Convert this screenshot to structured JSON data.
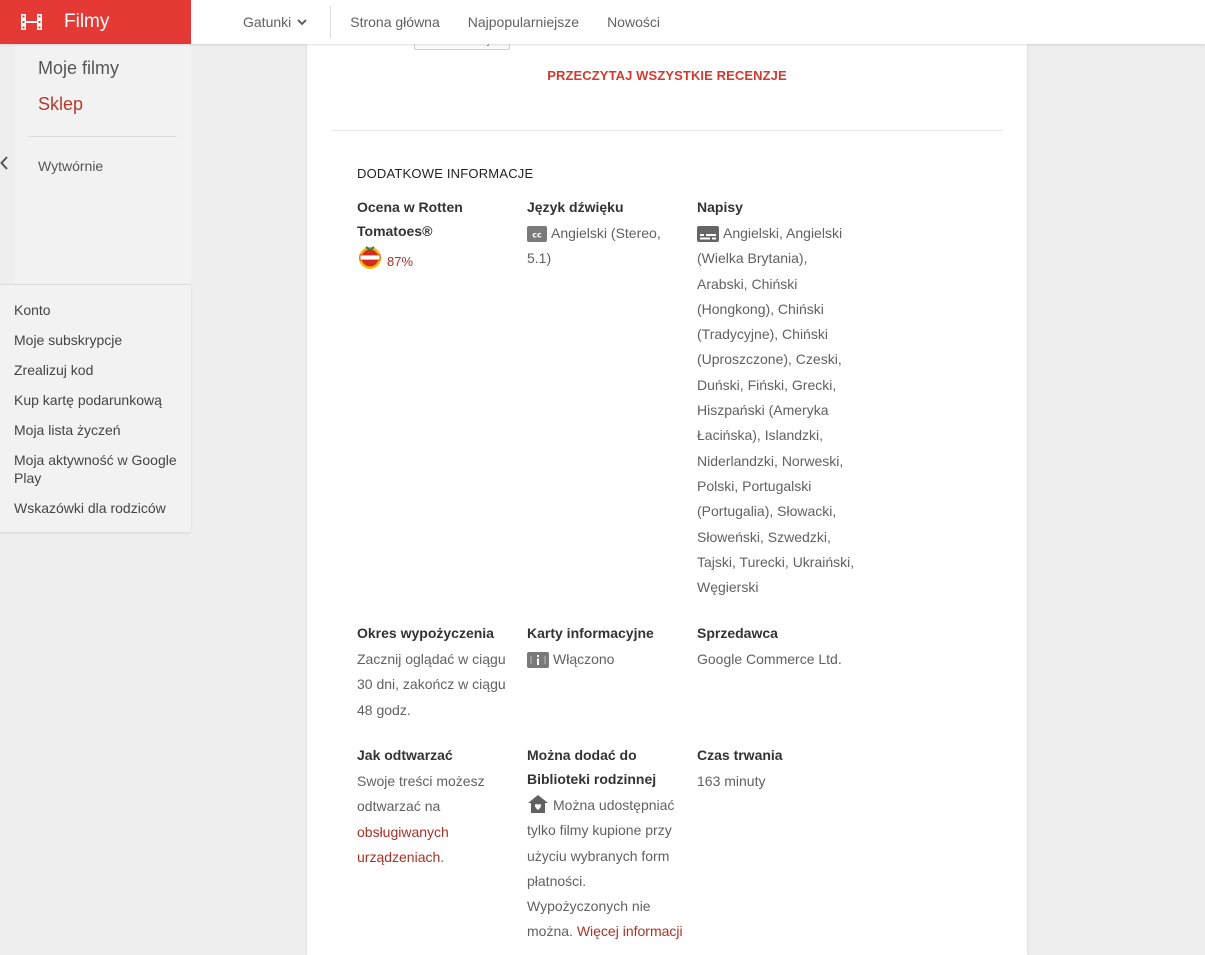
{
  "app": {
    "title": "Filmy"
  },
  "nav": {
    "genres": "Gatunki",
    "links": [
      "Strona główna",
      "Najpopularniejsze",
      "Nowości"
    ]
  },
  "sidebar": {
    "main": [
      "Moje filmy",
      "Sklep"
    ],
    "active": "Sklep",
    "studios": "Wytwórnie",
    "menu": [
      "Konto",
      "Moje subskrypcje",
      "Zrealizuj kod",
      "Kup kartę podarunkową",
      "Moja lista życzeń",
      "Moja aktywność w Google Play",
      "Wskazówki dla rodziców"
    ]
  },
  "reviews": {
    "full_review_button": "Pełna recenzja",
    "read_all": "PRZECZYTAJ WSZYSTKIE RECENZJE"
  },
  "additional_info": {
    "title": "DODATKOWE INFORMACJE",
    "rotten": {
      "label": "Ocena w Rotten Tomatoes®",
      "value": "87%"
    },
    "audio": {
      "label": "Język dźwięku",
      "value": "Angielski (Stereo, 5.1)"
    },
    "subtitles": {
      "label": "Napisy",
      "value": "Angielski, Angielski (Wielka Brytania), Arabski, Chiński (Hongkong), Chiński (Tradycyjne), Chiński (Uproszczone), Czeski, Duński, Fiński, Grecki, Hiszpański (Ameryka Łacińska), Islandzki, Niderlandzki, Norweski, Polski, Portugalski (Portugalia), Słowacki, Słoweński, Szwedzki, Tajski, Turecki, Ukraiński, Węgierski"
    },
    "rental": {
      "label": "Okres wypożyczenia",
      "value": "Zacznij oglądać w ciągu 30 dni, zakończ w ciągu 48 godz."
    },
    "info_cards": {
      "label": "Karty informacyjne",
      "value": "Włączono"
    },
    "seller": {
      "label": "Sprzedawca",
      "value": "Google Commerce Ltd."
    },
    "how_to_play": {
      "label": "Jak odtwarzać",
      "text": "Swoje treści możesz odtwarzać na ",
      "link": "obsługiwanych urządzeniach",
      "after": "."
    },
    "family": {
      "label": "Można dodać do Biblioteki rodzinnej",
      "text": "Można udostępniać tylko filmy kupione przy użyciu wybranych form płatności. Wypożyczonych nie można. ",
      "link": "Więcej informacji"
    },
    "duration": {
      "label": "Czas trwania",
      "value": "163 minuty"
    }
  },
  "colors": {
    "brand": "#e53935",
    "accent": "#b53a2e",
    "link": "#a93226"
  }
}
